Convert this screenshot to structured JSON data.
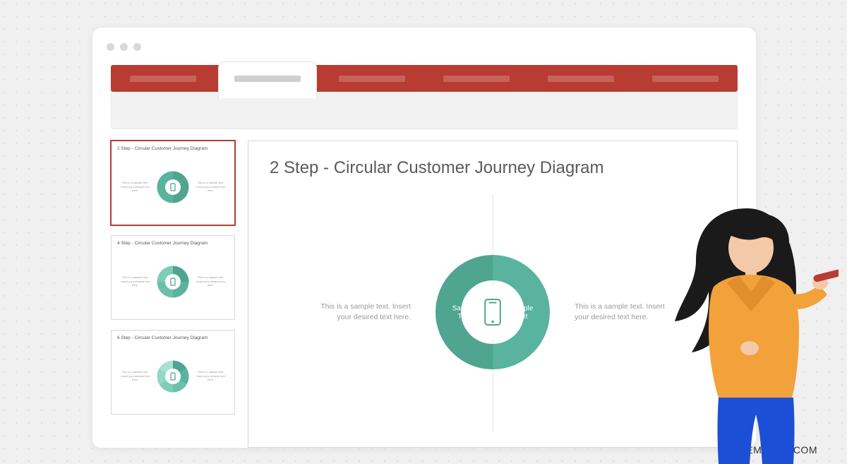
{
  "brand": "SLIDEMODEL.COM",
  "colors": {
    "ribbon": "#b83c32",
    "accent": "#4fa590",
    "gray_bg": "#f0f0f0"
  },
  "ribbon": {
    "tabs": [
      {
        "active": false
      },
      {
        "active": true
      },
      {
        "active": false
      },
      {
        "active": false
      },
      {
        "active": false
      },
      {
        "active": false
      }
    ]
  },
  "thumbs": [
    {
      "title": "2 Step - Circular Customer Journey Diagram",
      "segments": 2,
      "selected": true,
      "hint": "This is a sample text. Insert your desired text here."
    },
    {
      "title": "4 Step - Circular Customer Journey Diagram",
      "segments": 4,
      "selected": false,
      "hint": "This is a sample text. Insert your desired text here."
    },
    {
      "title": "6 Step - Circular Customer Journey Diagram",
      "segments": 6,
      "selected": false,
      "hint": "This is a sample text. Insert your desired text here."
    }
  ],
  "slide": {
    "title": "2 Step - Circular Customer Journey Diagram",
    "left_text": "This is a sample text. Insert your desired text here.",
    "right_text": "This is a sample text. Insert your desired text here.",
    "seg_left_label": "Sample Text",
    "seg_right_label": "Sample Text",
    "center_icon": "smartphone-icon"
  }
}
